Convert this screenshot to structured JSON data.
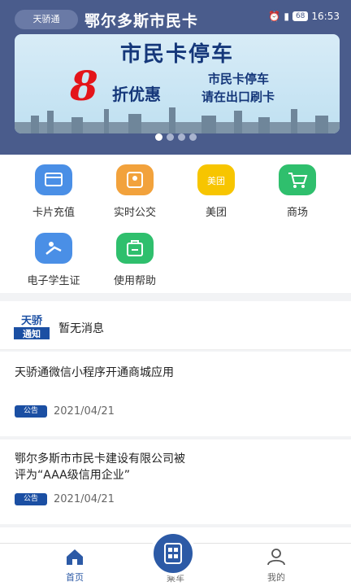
{
  "status": {
    "time": "16:53",
    "battery": "68"
  },
  "header": {
    "logo": "天骄通",
    "title": "鄂尔多斯市民卡"
  },
  "banner": {
    "title": "市民卡停车",
    "big": "8",
    "discount": "折优惠",
    "line1": "市民卡停车",
    "line2": "请在出口刷卡",
    "page_count": 4
  },
  "grid": [
    {
      "label": "卡片充值",
      "icon": "card-icon",
      "color": "#4a8fe6"
    },
    {
      "label": "实时公交",
      "icon": "map-icon",
      "color": "#f2a23c"
    },
    {
      "label": "美团",
      "icon": "meituan-icon",
      "color": "#f7c500"
    },
    {
      "label": "商场",
      "icon": "cart-icon",
      "color": "#2fbf6d"
    },
    {
      "label": "电子学生证",
      "icon": "student-icon",
      "color": "#4a8fe6"
    },
    {
      "label": "使用帮助",
      "icon": "help-bag-icon",
      "color": "#2fbf6d"
    }
  ],
  "notice": {
    "logo_text1": "天骄",
    "logo_text2": "通知",
    "text": "暂无消息"
  },
  "articles": [
    {
      "title": "天骄通微信小程序开通商城应用",
      "tag": "公告",
      "date": "2021/04/21"
    },
    {
      "title": "鄂尔多斯市市民卡建设有限公司被评为“AAA级信用企业”",
      "title_line1": "鄂尔多斯市市民卡建设有限公司被",
      "title_line2": "评为“AAA级信用企业”",
      "tag": "公告",
      "date": "2021/04/21"
    }
  ],
  "tabs": {
    "home": "首页",
    "ride": "乘车",
    "mine": "我的"
  },
  "colors": {
    "accent": "#2c5aa6",
    "header": "#4a5c8c"
  }
}
